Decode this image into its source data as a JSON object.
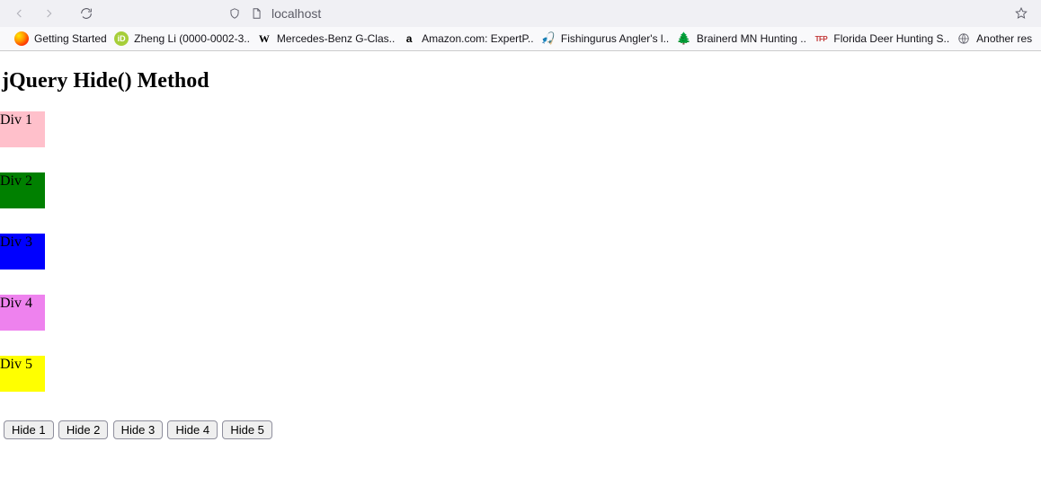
{
  "browser": {
    "url": "localhost",
    "bookmarks": [
      {
        "icon": "firefox",
        "label": "Getting Started"
      },
      {
        "icon": "orcid",
        "label": "Zheng Li (0000-0002-3..."
      },
      {
        "icon": "wiki",
        "label": "Mercedes-Benz G-Clas..."
      },
      {
        "icon": "amazon",
        "label": "Amazon.com: ExpertP..."
      },
      {
        "icon": "fishing",
        "label": "Fishingurus Angler's l..."
      },
      {
        "icon": "tree",
        "label": "Brainerd MN Hunting ..."
      },
      {
        "icon": "tfp",
        "label": "Florida Deer Hunting S..."
      },
      {
        "icon": "globe",
        "label": "Another res"
      }
    ]
  },
  "page": {
    "heading": "jQuery Hide() Method",
    "divs": [
      {
        "label": "Div 1",
        "color": "#ffc0cb"
      },
      {
        "label": "Div 2",
        "color": "#008000"
      },
      {
        "label": "Div 3",
        "color": "#0000ff"
      },
      {
        "label": "Div 4",
        "color": "#ee82ee"
      },
      {
        "label": "Div 5",
        "color": "#ffff00"
      }
    ],
    "buttons": [
      {
        "label": "Hide 1"
      },
      {
        "label": "Hide 2"
      },
      {
        "label": "Hide 3"
      },
      {
        "label": "Hide 4"
      },
      {
        "label": "Hide 5"
      }
    ]
  }
}
